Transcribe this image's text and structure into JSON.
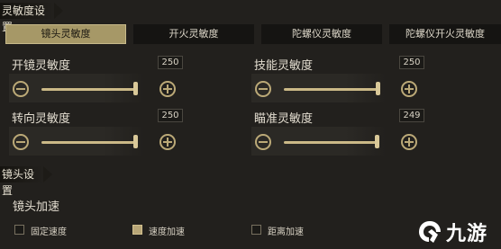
{
  "section_sensitivity": {
    "title": "灵敏度设置"
  },
  "tabs": [
    {
      "label": "镜头灵敏度",
      "active": true
    },
    {
      "label": "开火灵敏度",
      "active": false
    },
    {
      "label": "陀螺仪灵敏度",
      "active": false
    },
    {
      "label": "陀螺仪开火灵敏度",
      "active": false
    }
  ],
  "sliders": [
    {
      "label": "开镜灵敏度",
      "value": "250"
    },
    {
      "label": "技能灵敏度",
      "value": "250"
    },
    {
      "label": "转向灵敏度",
      "value": "250"
    },
    {
      "label": "瞄准灵敏度",
      "value": "249"
    }
  ],
  "section_lens": {
    "title": "镜头设置"
  },
  "lens_speed": {
    "label": "镜头加速",
    "options": [
      {
        "label": "固定速度",
        "checked": false
      },
      {
        "label": "速度加速",
        "checked": true
      },
      {
        "label": "距离加速",
        "checked": false
      }
    ]
  },
  "watermark": {
    "text": "九游"
  },
  "colors": {
    "accent": "#a69867",
    "track": "#cbb987",
    "background": "#22201d"
  },
  "icons": {
    "decrease": "minus-circle-icon",
    "increase": "plus-circle-icon"
  }
}
